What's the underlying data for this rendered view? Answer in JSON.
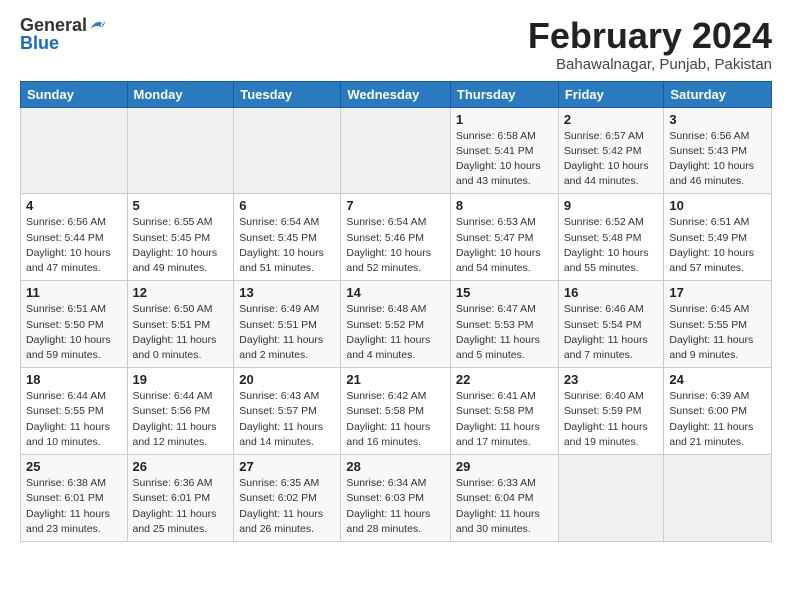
{
  "logo": {
    "text_general": "General",
    "text_blue": "Blue"
  },
  "header": {
    "month": "February 2024",
    "location": "Bahawalnagar, Punjab, Pakistan"
  },
  "weekdays": [
    "Sunday",
    "Monday",
    "Tuesday",
    "Wednesday",
    "Thursday",
    "Friday",
    "Saturday"
  ],
  "weeks": [
    [
      {
        "day": "",
        "sunrise": "",
        "sunset": "",
        "daylight": ""
      },
      {
        "day": "",
        "sunrise": "",
        "sunset": "",
        "daylight": ""
      },
      {
        "day": "",
        "sunrise": "",
        "sunset": "",
        "daylight": ""
      },
      {
        "day": "",
        "sunrise": "",
        "sunset": "",
        "daylight": ""
      },
      {
        "day": "1",
        "sunrise": "Sunrise: 6:58 AM",
        "sunset": "Sunset: 5:41 PM",
        "daylight": "Daylight: 10 hours and 43 minutes."
      },
      {
        "day": "2",
        "sunrise": "Sunrise: 6:57 AM",
        "sunset": "Sunset: 5:42 PM",
        "daylight": "Daylight: 10 hours and 44 minutes."
      },
      {
        "day": "3",
        "sunrise": "Sunrise: 6:56 AM",
        "sunset": "Sunset: 5:43 PM",
        "daylight": "Daylight: 10 hours and 46 minutes."
      }
    ],
    [
      {
        "day": "4",
        "sunrise": "Sunrise: 6:56 AM",
        "sunset": "Sunset: 5:44 PM",
        "daylight": "Daylight: 10 hours and 47 minutes."
      },
      {
        "day": "5",
        "sunrise": "Sunrise: 6:55 AM",
        "sunset": "Sunset: 5:45 PM",
        "daylight": "Daylight: 10 hours and 49 minutes."
      },
      {
        "day": "6",
        "sunrise": "Sunrise: 6:54 AM",
        "sunset": "Sunset: 5:45 PM",
        "daylight": "Daylight: 10 hours and 51 minutes."
      },
      {
        "day": "7",
        "sunrise": "Sunrise: 6:54 AM",
        "sunset": "Sunset: 5:46 PM",
        "daylight": "Daylight: 10 hours and 52 minutes."
      },
      {
        "day": "8",
        "sunrise": "Sunrise: 6:53 AM",
        "sunset": "Sunset: 5:47 PM",
        "daylight": "Daylight: 10 hours and 54 minutes."
      },
      {
        "day": "9",
        "sunrise": "Sunrise: 6:52 AM",
        "sunset": "Sunset: 5:48 PM",
        "daylight": "Daylight: 10 hours and 55 minutes."
      },
      {
        "day": "10",
        "sunrise": "Sunrise: 6:51 AM",
        "sunset": "Sunset: 5:49 PM",
        "daylight": "Daylight: 10 hours and 57 minutes."
      }
    ],
    [
      {
        "day": "11",
        "sunrise": "Sunrise: 6:51 AM",
        "sunset": "Sunset: 5:50 PM",
        "daylight": "Daylight: 10 hours and 59 minutes."
      },
      {
        "day": "12",
        "sunrise": "Sunrise: 6:50 AM",
        "sunset": "Sunset: 5:51 PM",
        "daylight": "Daylight: 11 hours and 0 minutes."
      },
      {
        "day": "13",
        "sunrise": "Sunrise: 6:49 AM",
        "sunset": "Sunset: 5:51 PM",
        "daylight": "Daylight: 11 hours and 2 minutes."
      },
      {
        "day": "14",
        "sunrise": "Sunrise: 6:48 AM",
        "sunset": "Sunset: 5:52 PM",
        "daylight": "Daylight: 11 hours and 4 minutes."
      },
      {
        "day": "15",
        "sunrise": "Sunrise: 6:47 AM",
        "sunset": "Sunset: 5:53 PM",
        "daylight": "Daylight: 11 hours and 5 minutes."
      },
      {
        "day": "16",
        "sunrise": "Sunrise: 6:46 AM",
        "sunset": "Sunset: 5:54 PM",
        "daylight": "Daylight: 11 hours and 7 minutes."
      },
      {
        "day": "17",
        "sunrise": "Sunrise: 6:45 AM",
        "sunset": "Sunset: 5:55 PM",
        "daylight": "Daylight: 11 hours and 9 minutes."
      }
    ],
    [
      {
        "day": "18",
        "sunrise": "Sunrise: 6:44 AM",
        "sunset": "Sunset: 5:55 PM",
        "daylight": "Daylight: 11 hours and 10 minutes."
      },
      {
        "day": "19",
        "sunrise": "Sunrise: 6:44 AM",
        "sunset": "Sunset: 5:56 PM",
        "daylight": "Daylight: 11 hours and 12 minutes."
      },
      {
        "day": "20",
        "sunrise": "Sunrise: 6:43 AM",
        "sunset": "Sunset: 5:57 PM",
        "daylight": "Daylight: 11 hours and 14 minutes."
      },
      {
        "day": "21",
        "sunrise": "Sunrise: 6:42 AM",
        "sunset": "Sunset: 5:58 PM",
        "daylight": "Daylight: 11 hours and 16 minutes."
      },
      {
        "day": "22",
        "sunrise": "Sunrise: 6:41 AM",
        "sunset": "Sunset: 5:58 PM",
        "daylight": "Daylight: 11 hours and 17 minutes."
      },
      {
        "day": "23",
        "sunrise": "Sunrise: 6:40 AM",
        "sunset": "Sunset: 5:59 PM",
        "daylight": "Daylight: 11 hours and 19 minutes."
      },
      {
        "day": "24",
        "sunrise": "Sunrise: 6:39 AM",
        "sunset": "Sunset: 6:00 PM",
        "daylight": "Daylight: 11 hours and 21 minutes."
      }
    ],
    [
      {
        "day": "25",
        "sunrise": "Sunrise: 6:38 AM",
        "sunset": "Sunset: 6:01 PM",
        "daylight": "Daylight: 11 hours and 23 minutes."
      },
      {
        "day": "26",
        "sunrise": "Sunrise: 6:36 AM",
        "sunset": "Sunset: 6:01 PM",
        "daylight": "Daylight: 11 hours and 25 minutes."
      },
      {
        "day": "27",
        "sunrise": "Sunrise: 6:35 AM",
        "sunset": "Sunset: 6:02 PM",
        "daylight": "Daylight: 11 hours and 26 minutes."
      },
      {
        "day": "28",
        "sunrise": "Sunrise: 6:34 AM",
        "sunset": "Sunset: 6:03 PM",
        "daylight": "Daylight: 11 hours and 28 minutes."
      },
      {
        "day": "29",
        "sunrise": "Sunrise: 6:33 AM",
        "sunset": "Sunset: 6:04 PM",
        "daylight": "Daylight: 11 hours and 30 minutes."
      },
      {
        "day": "",
        "sunrise": "",
        "sunset": "",
        "daylight": ""
      },
      {
        "day": "",
        "sunrise": "",
        "sunset": "",
        "daylight": ""
      }
    ]
  ]
}
